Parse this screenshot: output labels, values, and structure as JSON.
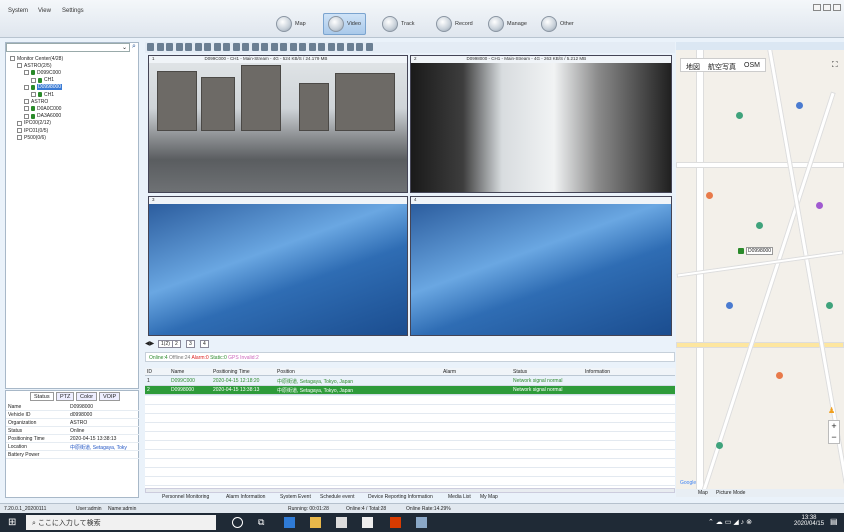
{
  "menubar": {
    "items": [
      "System",
      "View",
      "Settings"
    ],
    "nav": [
      "Map",
      "Video",
      "Track",
      "Record",
      "Manage",
      "Other"
    ]
  },
  "tree": {
    "nodes": [
      {
        "label": "Monitor Center(4/28)",
        "level": 0,
        "type": "root"
      },
      {
        "label": "ASTRO(2/5)",
        "level": 1,
        "type": "group"
      },
      {
        "label": "D099C000",
        "level": 2,
        "type": "vehicle"
      },
      {
        "label": "CH1",
        "level": 3,
        "type": "channel"
      },
      {
        "label": "D0998000",
        "level": 2,
        "type": "vehicle",
        "selected": true
      },
      {
        "label": "CH1",
        "level": 3,
        "type": "channel"
      },
      {
        "label": "ASTRO",
        "level": 2,
        "type": "group"
      },
      {
        "label": "D0A0C000",
        "level": 2,
        "type": "vehicle"
      },
      {
        "label": "DA3A6000",
        "level": 2,
        "type": "vehicle"
      },
      {
        "label": "IPC00(2/12)",
        "level": 1,
        "type": "group"
      },
      {
        "label": "IPC01(0/5)",
        "level": 1,
        "type": "group"
      },
      {
        "label": "P500(0/6)",
        "level": 1,
        "type": "group"
      }
    ]
  },
  "info": {
    "tabs": [
      "Status",
      "PTZ",
      "Color",
      "VOIP"
    ],
    "rows": [
      {
        "k": "Name",
        "v": "D0998000"
      },
      {
        "k": "Vehicle ID",
        "v": "d0998000"
      },
      {
        "k": "Organization",
        "v": "ASTRO"
      },
      {
        "k": "Status",
        "v": "Online"
      },
      {
        "k": "Positioning Time",
        "v": "2020-04-15 13:38:13"
      },
      {
        "k": "Location",
        "v": "中原街道, Setagaya, Toky"
      },
      {
        "k": "Battery Power",
        "v": ""
      }
    ]
  },
  "videos": [
    {
      "num": "1",
      "title": "D099C000 - CH1 - Main-Stream - 4G - 524 KB/S / 24.179 MB",
      "scene": "street"
    },
    {
      "num": "2",
      "title": "D0998000 - CH1 - Main-Stream - 4G - 263 KB/S / 5.212 MB",
      "scene": "dark"
    },
    {
      "num": "3",
      "title": "",
      "scene": "blue"
    },
    {
      "num": "4",
      "title": "",
      "scene": "blue"
    }
  ],
  "pages": [
    "1(2)",
    "2",
    "3",
    "4"
  ],
  "counts": {
    "online": "Online:4",
    "offline": "Offline:24",
    "alarm": "Alarm:0",
    "static": "Static:0",
    "gps": "GPS Invalid:2"
  },
  "grid": {
    "cols": [
      "ID",
      "Name",
      "Positioning Time",
      "Position",
      "Alarm",
      "Status",
      "Information"
    ],
    "rows": [
      {
        "id": "1",
        "name": "D099C000",
        "time": "2020-04-15 12:18:20",
        "pos": "中原街道, Setagaya, Tokyo, Japan",
        "alarm": "",
        "status": "Network signal normal",
        "info": ""
      },
      {
        "id": "2",
        "name": "D0998000",
        "time": "2020-04-15 13:38:13",
        "pos": "中原街道, Setagaya, Tokyo, Japan",
        "alarm": "",
        "status": "Network signal normal",
        "info": ""
      }
    ]
  },
  "bottomtabs": [
    "Personnel Monitoring",
    "Alarm Information",
    "System Event",
    "Schedule event",
    "Device Reporting Information",
    "Media List",
    "My Map"
  ],
  "map": {
    "tabs": [
      "地図",
      "航空写真",
      "OSM"
    ],
    "footer_tabs": [
      "Map",
      "Picture Mode"
    ],
    "marker": "D0998000"
  },
  "status": {
    "version": "7.20.0.1_20200111",
    "user": "User:admin",
    "name": "Name:admin",
    "running": "Running: 00:01:28",
    "online": "Online:4 / Total:28",
    "rate": "Online Rate:14.29%"
  },
  "taskbar": {
    "search": "ここに入力して検索",
    "time": "13:38",
    "date": "2020/04/15"
  }
}
